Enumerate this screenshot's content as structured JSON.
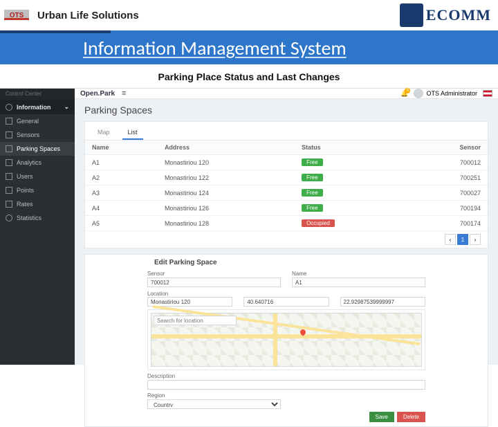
{
  "slide": {
    "company": "Urban Life Solutions",
    "title": "Information Management System",
    "subtitle": "Parking Place Status and Last Changes",
    "ecomm": "ECOMM"
  },
  "app": {
    "brand": "Open.Park",
    "notif_count": "0",
    "user_name": "OTS Administrator"
  },
  "sidebar": {
    "ctrl_center": "Control Center",
    "information": "Information",
    "items": [
      {
        "label": "General"
      },
      {
        "label": "Sensors"
      },
      {
        "label": "Parking Spaces"
      },
      {
        "label": "Analytics"
      },
      {
        "label": "Users"
      },
      {
        "label": "Points"
      },
      {
        "label": "Rates"
      }
    ],
    "statistics": "Statistics"
  },
  "page": {
    "title": "Parking Spaces",
    "tabs": {
      "map": "Map",
      "list": "List"
    },
    "cols": {
      "name": "Name",
      "address": "Address",
      "status": "Status",
      "sensor": "Sensor"
    },
    "rows": [
      {
        "name": "A1",
        "address": "Monastiriou 120",
        "status": "Free",
        "status_cls": "free",
        "sensor": "700012"
      },
      {
        "name": "A2",
        "address": "Monastiriou 122",
        "status": "Free",
        "status_cls": "free",
        "sensor": "700251"
      },
      {
        "name": "A3",
        "address": "Monastiriou 124",
        "status": "Free",
        "status_cls": "free",
        "sensor": "700027"
      },
      {
        "name": "A4",
        "address": "Monastiriou 126",
        "status": "Free",
        "status_cls": "free",
        "sensor": "700194"
      },
      {
        "name": "A5",
        "address": "Monastiriou 128",
        "status": "Occupied",
        "status_cls": "occ",
        "sensor": "700174"
      }
    ],
    "pager": {
      "prev": "‹",
      "cur": "1",
      "next": "›"
    }
  },
  "edit": {
    "heading": "Edit Parking Space",
    "labels": {
      "sensor": "Sensor",
      "name": "Name",
      "location": "Location",
      "lat": "",
      "lng": "",
      "search": "Search for location",
      "desc": "Description",
      "region": "Region",
      "country": "Country"
    },
    "values": {
      "sensor": "700012",
      "name": "A1",
      "address": "Monastiriou 120",
      "lat": "40.640716",
      "lng": "22.92987539999997",
      "country": "Country"
    },
    "buttons": {
      "save": "Save",
      "delete": "Delete"
    }
  }
}
